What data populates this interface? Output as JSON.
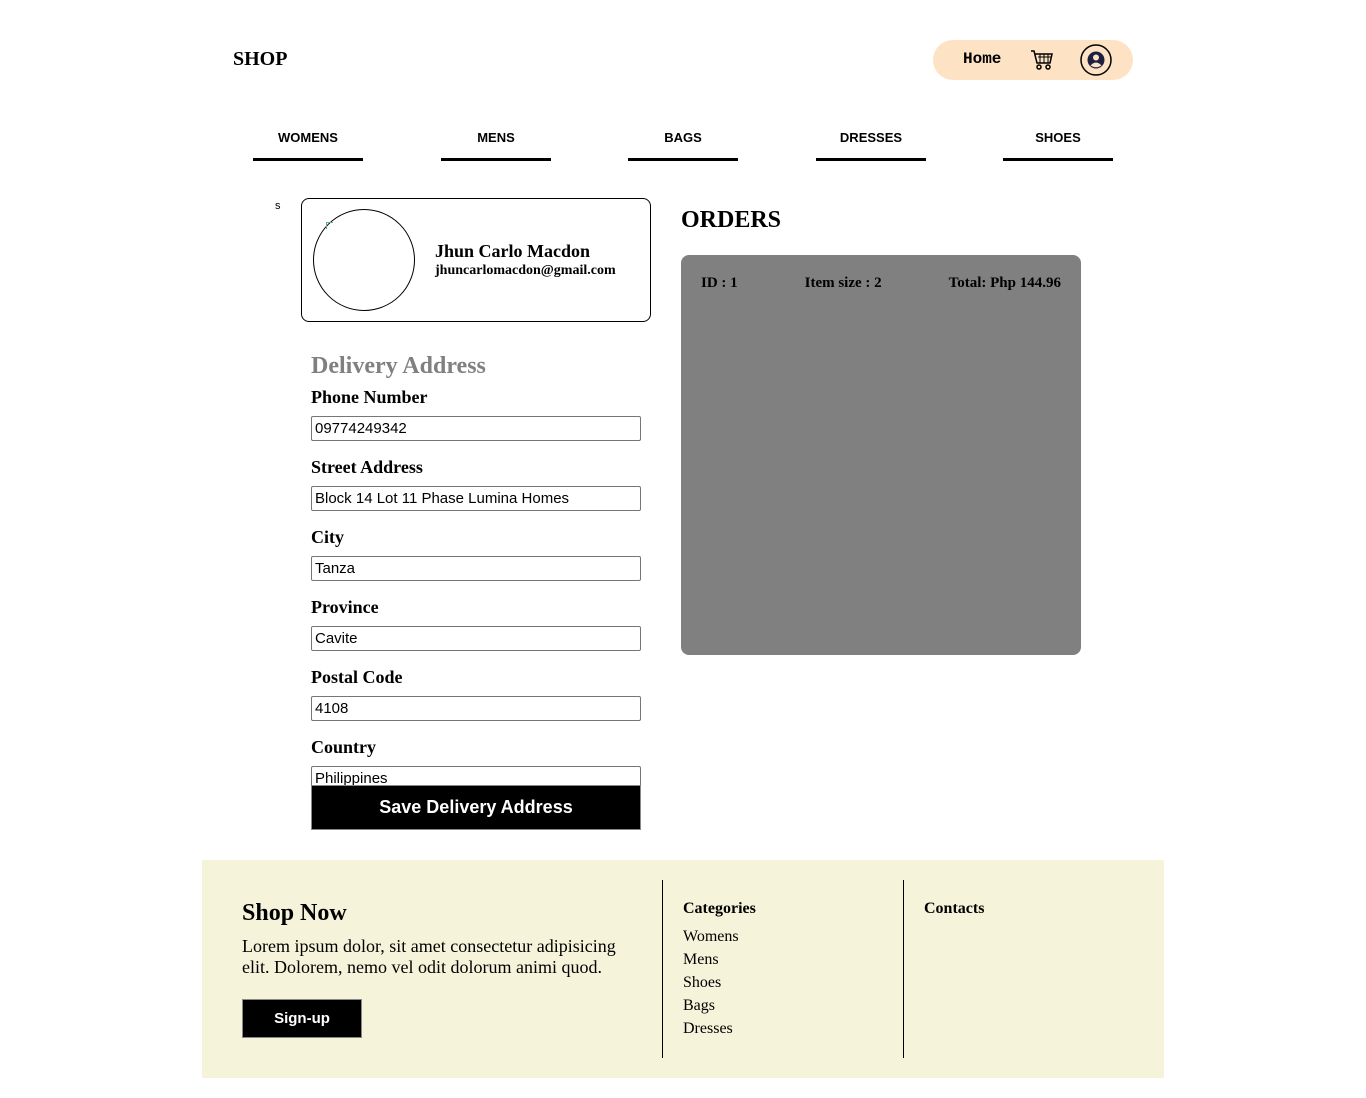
{
  "header": {
    "brand": "SHOP",
    "home_label": "Home",
    "accent_color": "#fde3c3"
  },
  "categories": [
    "WOMENS",
    "MENS",
    "BAGS",
    "DRESSES",
    "SHOES"
  ],
  "stray_text": "s",
  "profile": {
    "name": "Jhun Carlo Macdon",
    "email": "jhuncarlomacdon@gmail.com"
  },
  "delivery": {
    "title": "Delivery Address",
    "fields": [
      {
        "label": "Phone Number",
        "value": "09774249342"
      },
      {
        "label": "Street Address",
        "value": "Block 14 Lot 11 Phase Lumina Homes"
      },
      {
        "label": "City",
        "value": "Tanza"
      },
      {
        "label": "Province",
        "value": "Cavite"
      },
      {
        "label": "Postal Code",
        "value": "4108"
      },
      {
        "label": "Country",
        "value": "Philippines"
      }
    ],
    "save_label": "Save Delivery Address"
  },
  "orders": {
    "title": "ORDERS",
    "items": [
      {
        "id": "ID : 1",
        "size": "Item size : 2",
        "total": "Total: Php 144.96"
      }
    ]
  },
  "footer": {
    "title": "Shop Now",
    "text": "Lorem ipsum dolor, sit amet consectetur adipisicing elit. Dolorem, nemo vel odit dolorum animi quod.",
    "signup_label": "Sign-up",
    "categories_title": "Categories",
    "category_links": [
      "Womens",
      "Mens",
      "Shoes",
      "Bags",
      "Dresses"
    ],
    "contacts_title": "Contacts"
  }
}
